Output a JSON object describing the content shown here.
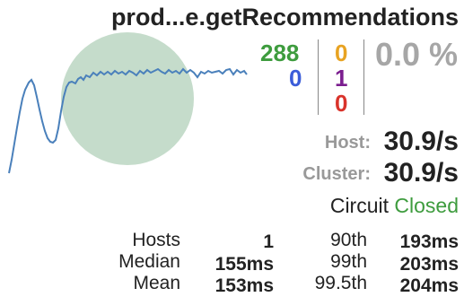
{
  "command": {
    "title": "prod...e.getRecommendations",
    "circle_color": "#c5dccb",
    "sparkline_color": "#4a80bb"
  },
  "counts": {
    "success": "288",
    "short_circuited": "0",
    "timeout": "0",
    "rejected": "1",
    "failure": "0"
  },
  "error_percentage": "0.0 %",
  "rates": {
    "host_label": "Host:",
    "host_value": "30.9/s",
    "cluster_label": "Cluster:",
    "cluster_value": "30.9/s"
  },
  "circuit": {
    "label": "Circuit",
    "state": "Closed"
  },
  "stats": {
    "hosts_label": "Hosts",
    "hosts_value": "1",
    "median_label": "Median",
    "median_value": "155ms",
    "mean_label": "Mean",
    "mean_value": "153ms",
    "p90_label": "90th",
    "p90_value": "193ms",
    "p99_label": "99th",
    "p99_value": "203ms",
    "p995_label": "99.5th",
    "p995_value": "204ms"
  }
}
